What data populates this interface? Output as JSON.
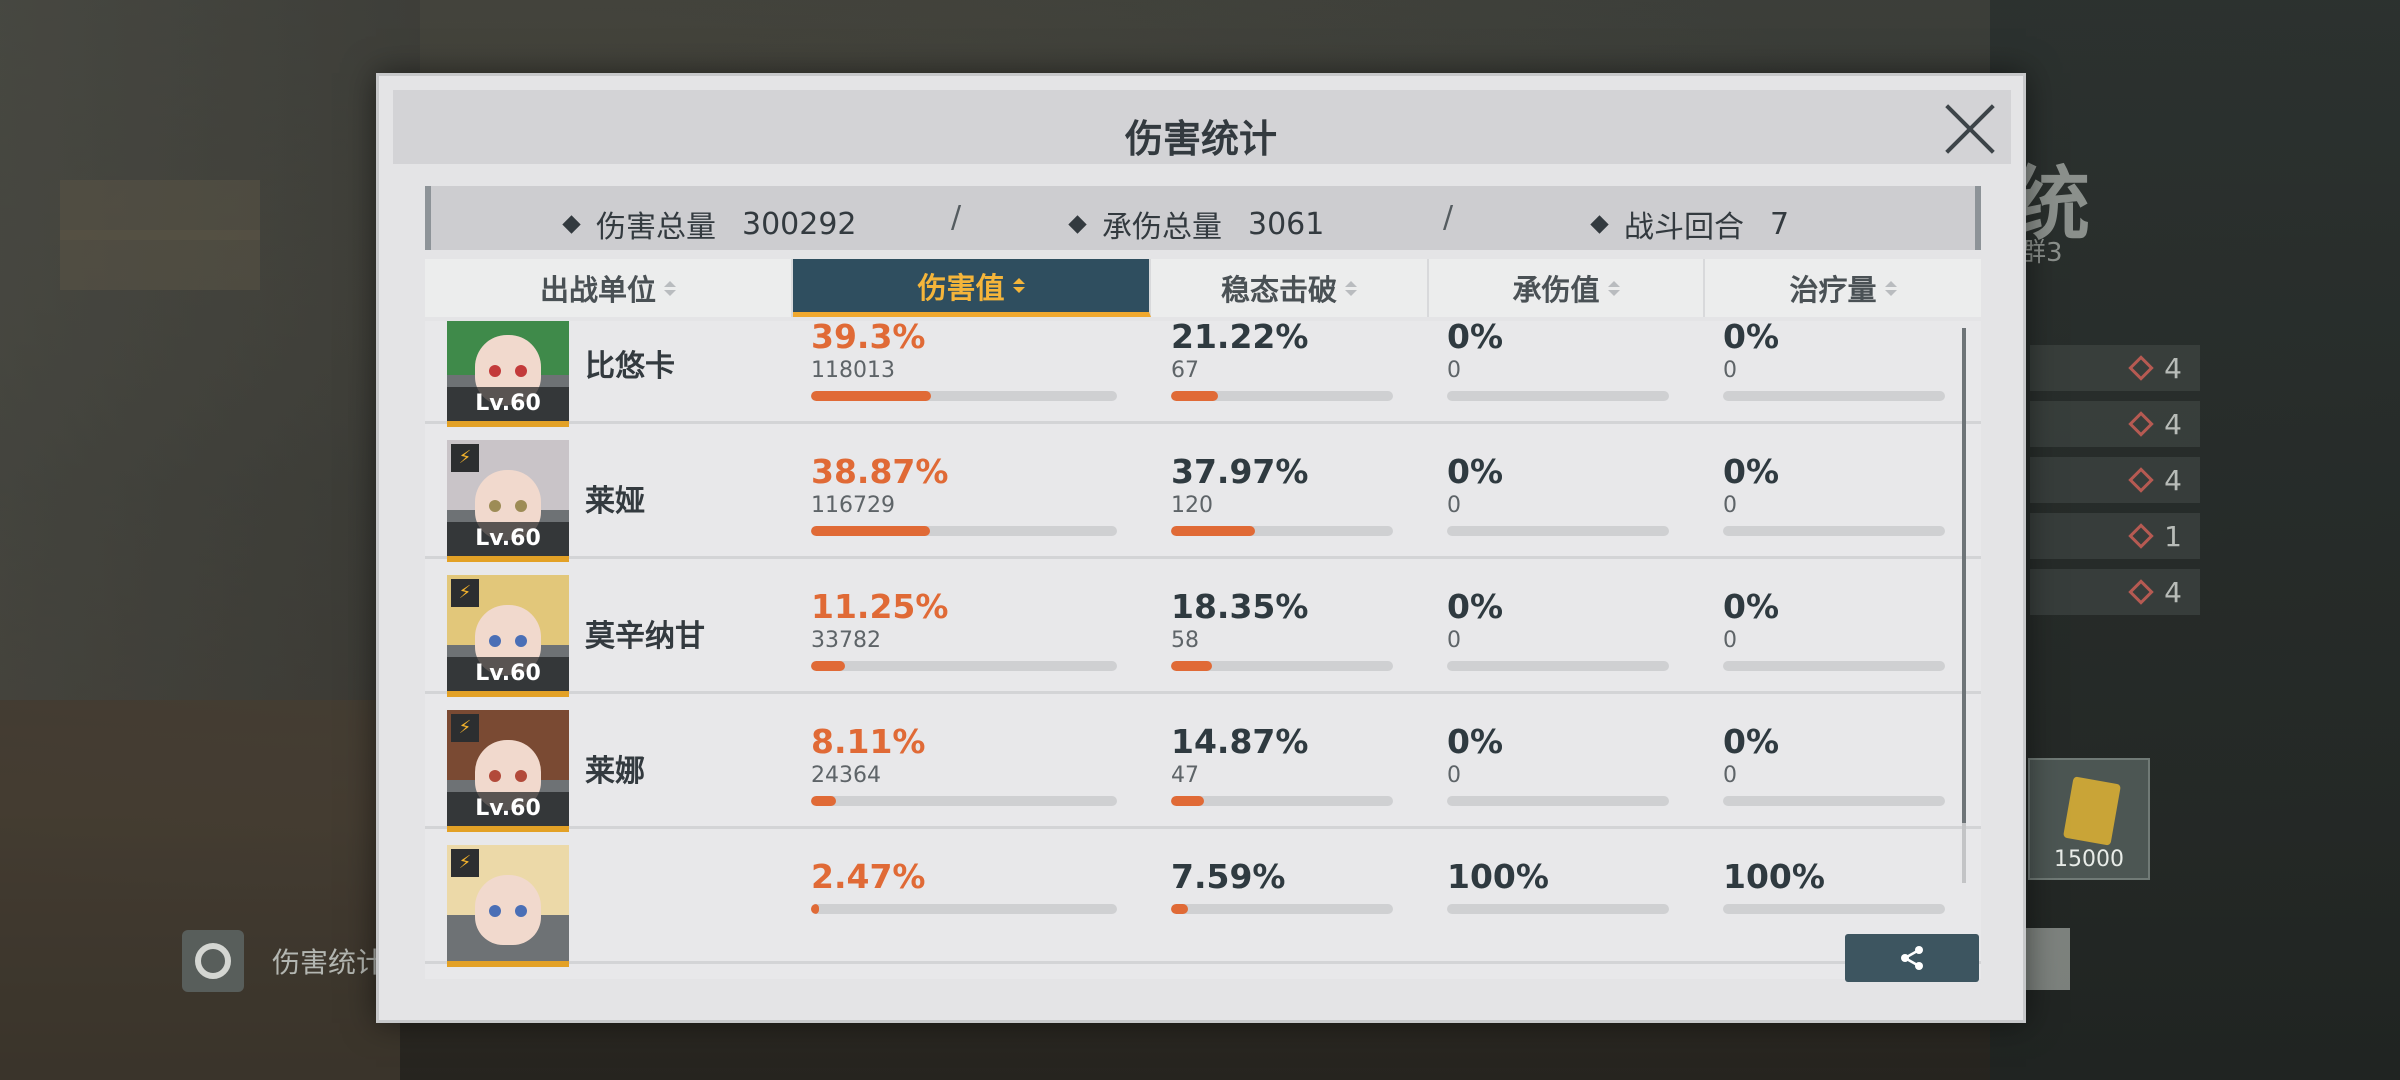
{
  "dialog": {
    "title": "伤害统计",
    "summary": [
      {
        "label": "伤害总量",
        "value": "300292"
      },
      {
        "label": "承伤总量",
        "value": "3061"
      },
      {
        "label": "战斗回合",
        "value": "7"
      }
    ],
    "separator": "/",
    "columns": [
      "出战单位",
      "伤害值",
      "稳态击破",
      "承伤值",
      "治疗量"
    ],
    "active_column": "伤害值",
    "rows": [
      {
        "name": "比悠卡",
        "level": "Lv.60",
        "hair": "#3f8a4a",
        "eyes": "#c33a3a",
        "damage_pct": "39.3%",
        "damage": "118013",
        "damage_fill": 0.393,
        "break_pct": "21.22%",
        "break": "67",
        "break_fill": 0.2122,
        "taken_pct": "0%",
        "taken": "0",
        "heal_pct": "0%",
        "heal": "0"
      },
      {
        "name": "莱娅",
        "level": "Lv.60",
        "hair": "#c9c4c8",
        "eyes": "#9d8c56",
        "damage_pct": "38.87%",
        "damage": "116729",
        "damage_fill": 0.3887,
        "break_pct": "37.97%",
        "break": "120",
        "break_fill": 0.3797,
        "taken_pct": "0%",
        "taken": "0",
        "heal_pct": "0%",
        "heal": "0"
      },
      {
        "name": "莫辛纳甘",
        "level": "Lv.60",
        "hair": "#e2c77a",
        "eyes": "#4a6fb6",
        "damage_pct": "11.25%",
        "damage": "33782",
        "damage_fill": 0.1125,
        "break_pct": "18.35%",
        "break": "58",
        "break_fill": 0.1835,
        "taken_pct": "0%",
        "taken": "0",
        "heal_pct": "0%",
        "heal": "0"
      },
      {
        "name": "莱娜",
        "level": "Lv.60",
        "hair": "#7a4a33",
        "eyes": "#b24a3a",
        "damage_pct": "8.11%",
        "damage": "24364",
        "damage_fill": 0.0811,
        "break_pct": "14.87%",
        "break": "47",
        "break_fill": 0.1487,
        "taken_pct": "0%",
        "taken": "0",
        "heal_pct": "0%",
        "heal": "0"
      },
      {
        "name": "",
        "level": "",
        "hair": "#ecd9a8",
        "eyes": "#4a6fb6",
        "damage_pct": "2.47%",
        "damage": "",
        "damage_fill": 0.0247,
        "break_pct": "7.59%",
        "break": "",
        "break_fill": 0.0759,
        "taken_pct": "100%",
        "taken": "",
        "heal_pct": "100%",
        "heal": ""
      }
    ]
  },
  "background": {
    "left_button_label": "伤害统计",
    "item_qty": "15000",
    "side_values": [
      "4",
      "4",
      "4",
      "1",
      "4"
    ],
    "group_label": "群3"
  },
  "colors": {
    "accent": "#e06a36",
    "active_header": "#2f4e5f",
    "active_text": "#f5b53a"
  }
}
